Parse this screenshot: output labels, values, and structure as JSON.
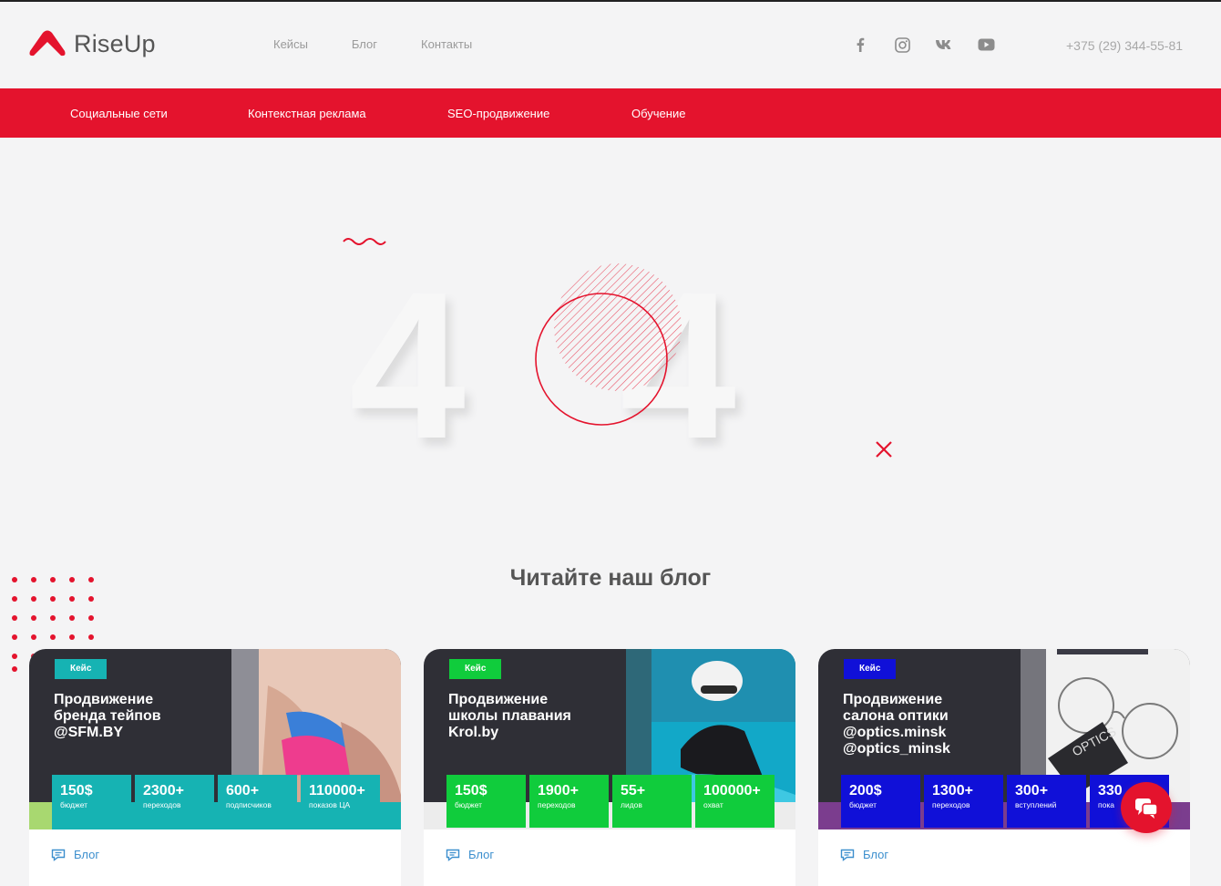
{
  "header": {
    "brand": "RiseUp",
    "nav": [
      "Кейсы",
      "Блог",
      "Контакты"
    ],
    "social_icons": [
      "facebook-icon",
      "instagram-icon",
      "vk-icon",
      "youtube-icon"
    ],
    "phone": "+375 (29) 344-55-81"
  },
  "menu": [
    "Социальные сети",
    "Контекстная реклама",
    "SEO-продвижение",
    "Обучение"
  ],
  "hero": {
    "digit_left": "4",
    "digit_right": "4"
  },
  "blog": {
    "title": "Читайте наш блог",
    "cards": [
      {
        "badge": "Кейс",
        "title_lines": [
          "Продвижение",
          "бренда тейпов",
          "@SFM.BY"
        ],
        "stats": [
          {
            "num": "150$",
            "label": "бюджет"
          },
          {
            "num": "2300+",
            "label": "переходов"
          },
          {
            "num": "600+",
            "label": "подписчиков"
          },
          {
            "num": "110000+",
            "label": "показов ЦА"
          }
        ],
        "category": "Блог"
      },
      {
        "badge": "Кейс",
        "title_lines": [
          "Продвижение",
          "школы плавания",
          "Krol.by"
        ],
        "stats": [
          {
            "num": "150$",
            "label": "бюджет"
          },
          {
            "num": "1900+",
            "label": "переходов"
          },
          {
            "num": "55+",
            "label": "лидов"
          },
          {
            "num": "100000+",
            "label": "охват"
          }
        ],
        "category": "Блог"
      },
      {
        "badge": "Кейс",
        "title_lines": [
          "Продвижение",
          "салона оптики",
          "@optics.minsk",
          "@optics_minsk"
        ],
        "stats": [
          {
            "num": "200$",
            "label": "бюджет"
          },
          {
            "num": "1300+",
            "label": "переходов"
          },
          {
            "num": "300+",
            "label": "вступлений"
          },
          {
            "num": "330",
            "label": "пока"
          }
        ],
        "category": "Блог"
      }
    ]
  },
  "colors": {
    "brand_red": "#e4132d",
    "teal": "#16b3b3",
    "green": "#10cc3c",
    "blue": "#1010d8"
  }
}
